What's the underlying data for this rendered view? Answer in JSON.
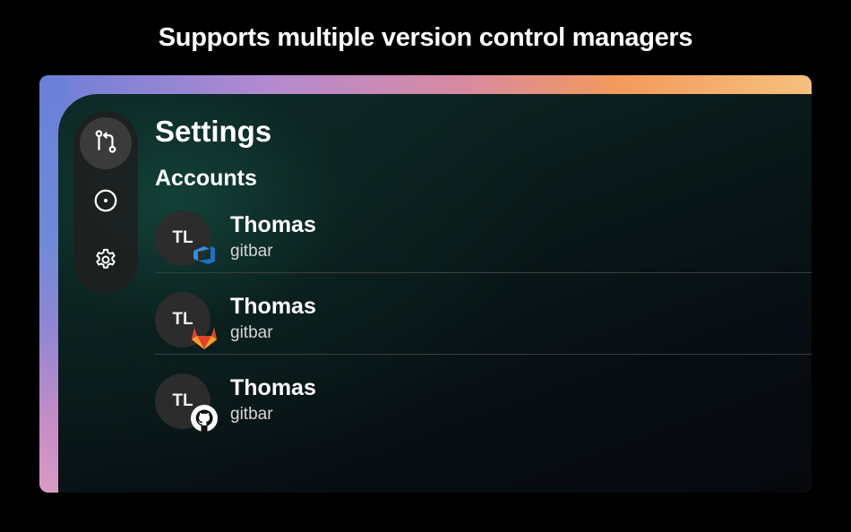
{
  "headline": "Supports multiple version control managers",
  "sidebar": {
    "items": [
      {
        "icon": "pull-request-icon",
        "active": true
      },
      {
        "icon": "issue-circle-icon",
        "active": false
      },
      {
        "icon": "gear-icon",
        "active": false
      }
    ]
  },
  "page": {
    "title": "Settings",
    "section": "Accounts"
  },
  "accounts": [
    {
      "initials": "TL",
      "name": "Thomas",
      "handle": "gitbar",
      "provider_icon": "azure-devops-icon"
    },
    {
      "initials": "TL",
      "name": "Thomas",
      "handle": "gitbar",
      "provider_icon": "gitlab-icon"
    },
    {
      "initials": "TL",
      "name": "Thomas",
      "handle": "gitbar",
      "provider_icon": "github-icon"
    }
  ],
  "colors": {
    "background": "#000000",
    "azure": "#2f8fe0",
    "gitlab_orange": "#fc6d26",
    "gitlab_red": "#e24329"
  }
}
